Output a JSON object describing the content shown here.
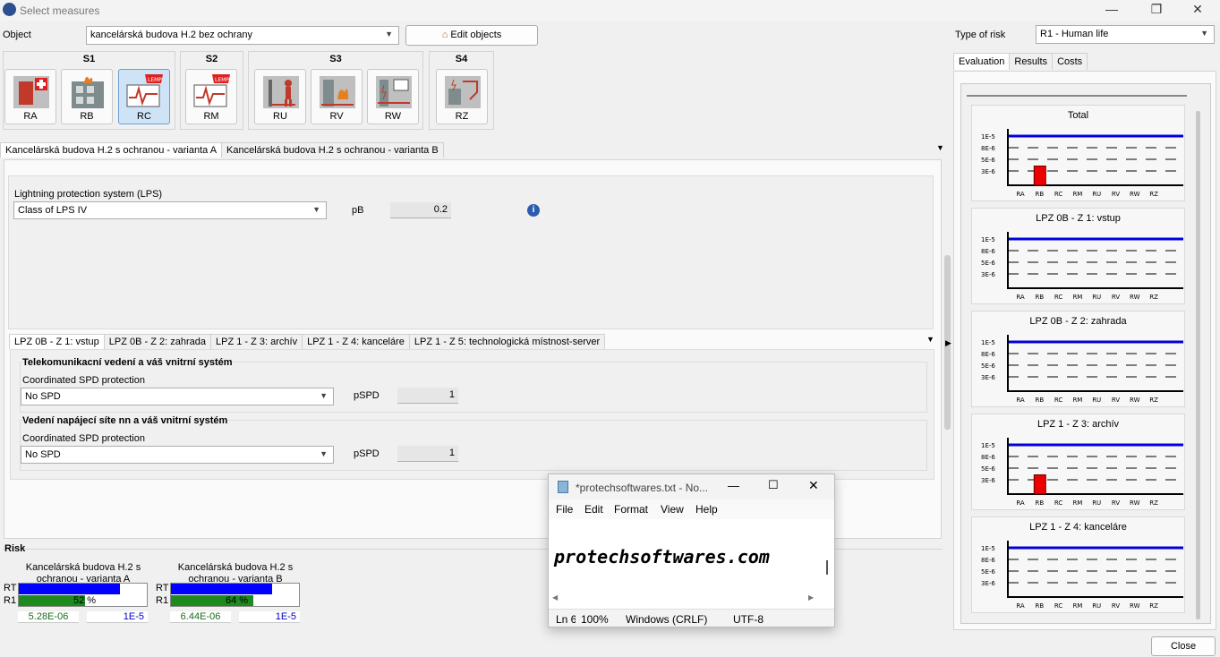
{
  "window": {
    "title": "Select measures",
    "close": "Close"
  },
  "object": {
    "label": "Object",
    "value": "kancelárská budova H.2 bez ochrany",
    "edit": "Edit objects"
  },
  "risk_type": {
    "label": "Type of risk",
    "value": "R1 - Human life"
  },
  "groups": [
    {
      "name": "S1"
    },
    {
      "name": "S2"
    },
    {
      "name": "S3"
    },
    {
      "name": "S4"
    }
  ],
  "measures": [
    {
      "label": "RA"
    },
    {
      "label": "RB"
    },
    {
      "label": "RC"
    },
    {
      "label": "RM"
    },
    {
      "label": "RU"
    },
    {
      "label": "RV"
    },
    {
      "label": "RW"
    },
    {
      "label": "RZ"
    }
  ],
  "variant_tabs": [
    "Kancelárská budova H.2 s ochranou - varianta A",
    "Kancelárská budova H.2 s ochranou - varianta B"
  ],
  "lps": {
    "label": "Lightning protection system (LPS)",
    "value": "Class of LPS IV",
    "param": "pB",
    "param_value": "0.2"
  },
  "zone_tabs": [
    "LPZ 0B - Z 1: vstup",
    "LPZ 0B - Z 2: zahrada",
    "LPZ 1 - Z 3: archív",
    "LPZ 1 - Z 4: kanceláre",
    "LPZ 1 - Z 5: technologická místnost-server"
  ],
  "lines": [
    {
      "title": "Telekomunikacní vedení a váš vnitrní systém",
      "label": "Coordinated SPD protection",
      "value": "No SPD",
      "param": "pSPD",
      "param_value": "1"
    },
    {
      "title": "Vedení napájecí síte nn a váš vnitrní systém",
      "label": "Coordinated SPD protection",
      "value": "No SPD",
      "param": "pSPD",
      "param_value": "1"
    }
  ],
  "risk": {
    "title": "Risk",
    "items": [
      {
        "name": "Kancelárská budova H.2 s ochranou - varianta A",
        "rt": "RT",
        "r1": "R1",
        "percent_text": "52 %",
        "percent": 0.52,
        "value": "5.28E-06",
        "limit": "1E-5"
      },
      {
        "name": "Kancelárská budova H.2 s ochranou - varianta B",
        "rt": "RT",
        "r1": "R1",
        "percent_text": "64 %",
        "percent": 0.64,
        "value": "6.44E-06",
        "limit": "1E-5"
      }
    ]
  },
  "right_tabs": [
    "Evaluation",
    "Results",
    "Costs"
  ],
  "chart_data": [
    {
      "type": "bar",
      "title": "Total",
      "categories": [
        "RA",
        "RB",
        "RC",
        "RM",
        "RU",
        "RV",
        "RW",
        "RZ"
      ],
      "values": [
        0,
        3.5e-06,
        0,
        0,
        0,
        0,
        0,
        0
      ],
      "yticks": [
        "1E-5",
        "8E-6",
        "5E-6",
        "3E-6"
      ],
      "limit": 1e-05
    },
    {
      "type": "bar",
      "title": "LPZ 0B - Z 1: vstup",
      "categories": [
        "RA",
        "RB",
        "RC",
        "RM",
        "RU",
        "RV",
        "RW",
        "RZ"
      ],
      "values": [
        0,
        0,
        0,
        0,
        0,
        0,
        0,
        0
      ],
      "yticks": [
        "1E-5",
        "8E-6",
        "5E-6",
        "3E-6"
      ],
      "limit": 1e-05
    },
    {
      "type": "bar",
      "title": "LPZ 0B - Z 2: zahrada",
      "categories": [
        "RA",
        "RB",
        "RC",
        "RM",
        "RU",
        "RV",
        "RW",
        "RZ"
      ],
      "values": [
        0,
        0,
        0,
        0,
        0,
        0,
        0,
        0
      ],
      "yticks": [
        "1E-5",
        "8E-6",
        "5E-6",
        "3E-6"
      ],
      "limit": 1e-05
    },
    {
      "type": "bar",
      "title": "LPZ 1 - Z 3: archív",
      "categories": [
        "RA",
        "RB",
        "RC",
        "RM",
        "RU",
        "RV",
        "RW",
        "RZ"
      ],
      "values": [
        0,
        3.5e-06,
        0,
        0,
        0,
        0,
        0,
        0
      ],
      "yticks": [
        "1E-5",
        "8E-6",
        "5E-6",
        "3E-6"
      ],
      "limit": 1e-05
    },
    {
      "type": "bar",
      "title": "LPZ 1 - Z 4: kanceláre",
      "categories": [
        "RA",
        "RB",
        "RC",
        "RM",
        "RU",
        "RV",
        "RW",
        "RZ"
      ],
      "values": [
        0,
        0,
        0,
        0,
        0,
        0,
        0,
        0
      ],
      "yticks": [
        "1E-5",
        "8E-6",
        "5E-6",
        "3E-6"
      ],
      "limit": 1e-05
    }
  ],
  "notepad": {
    "title": "*protechsoftwares.txt - No...",
    "menu": [
      "File",
      "Edit",
      "Format",
      "View",
      "Help"
    ],
    "text": "protechsoftwares.com",
    "status": [
      "Ln 6",
      "100%",
      "Windows (CRLF)",
      "UTF-8"
    ]
  }
}
